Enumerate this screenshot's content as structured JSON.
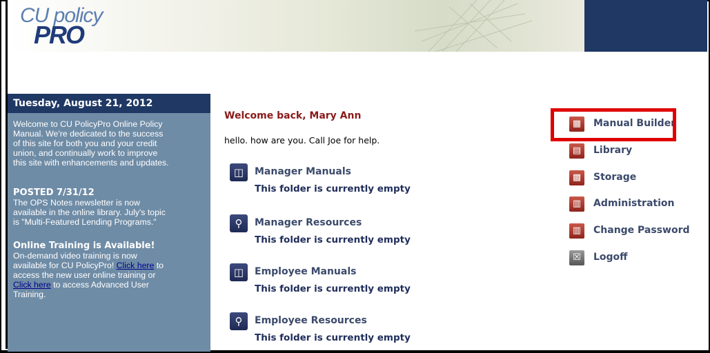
{
  "header": {
    "logo_top": "CU policy",
    "logo_bottom": "PRO"
  },
  "sidebar": {
    "date": "Tuesday, August 21, 2012",
    "intro_lines": [
      "Welcome to CU PolicyPro Online Policy",
      "Manual. We're dedicated to the success",
      "of this site for both you and your credit",
      "union, and continually work to improve",
      "this site with enhancements and updates."
    ],
    "posted_title": "POSTED 7/31/12",
    "posted_lines": [
      "The OPS Notes newsletter is now",
      "available in the online library. July's topic",
      "is \"Multi-Featured Lending Programs.\""
    ],
    "training_title": "Online Training is Available!",
    "training_line1": "On-demand video training is now",
    "training_line2_pre": "available for CU PolicyPro! ",
    "training_link1": "Click here",
    "training_line2_post": " to",
    "training_line3": "access the new user online training or",
    "training_link2": "Click here",
    "training_line4_post": " to access Advanced User",
    "training_line5": "Training."
  },
  "main": {
    "welcome": "Welcome back, Mary Ann",
    "message": "hello. how are you. Call Joe for help.",
    "folders": [
      {
        "label": "Manager Manuals",
        "status": "This folder is currently empty",
        "icon": "manual-icon"
      },
      {
        "label": "Manager Resources",
        "status": "This folder is currently empty",
        "icon": "resource-icon"
      },
      {
        "label": "Employee Manuals",
        "status": "This folder is currently empty",
        "icon": "manual-icon"
      },
      {
        "label": "Employee Resources",
        "status": "This folder is currently empty",
        "icon": "resource-icon"
      }
    ]
  },
  "nav": {
    "items": [
      {
        "label": "Manual Builder",
        "icon": "manual-builder-icon"
      },
      {
        "label": "Library",
        "icon": "library-icon"
      },
      {
        "label": "Storage",
        "icon": "storage-icon"
      },
      {
        "label": "Administration",
        "icon": "administration-icon"
      },
      {
        "label": "Change Password",
        "icon": "change-password-icon"
      },
      {
        "label": "Logoff",
        "icon": "logoff-icon"
      }
    ]
  },
  "colors": {
    "sidebar_bg": "#6f8ca6",
    "navy": "#1f3864",
    "welcome": "#8b1a1a",
    "highlight": "#e00000"
  }
}
